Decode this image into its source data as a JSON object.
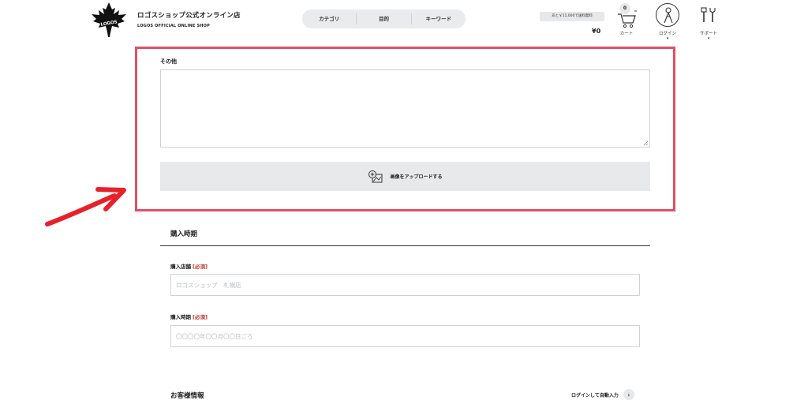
{
  "header": {
    "logo_text": "LOGOS",
    "brand_name_ja": "ロゴスショップ公式オンライン店",
    "brand_name_en": "LOGOS OFFICIAL ONLINE SHOP",
    "nav": [
      {
        "label": "カテゴリ"
      },
      {
        "label": "目的"
      },
      {
        "label": "キーワード"
      }
    ],
    "shipping_note": "あと￥11,000で送料無料",
    "cart_total": "¥0",
    "cart_count": "0",
    "cart_label": "カート",
    "login_label": "ログイン",
    "support_label": "サポート",
    "caret": "▾"
  },
  "other_section": {
    "label": "その他",
    "textarea_value": "",
    "upload_button_label": "画像をアップロードする"
  },
  "purchase_section": {
    "title": "購入時期",
    "store_field": {
      "label": "購入店舗",
      "required": "[必須]",
      "placeholder": "ロゴスショップ　札幌店"
    },
    "date_field": {
      "label": "購入時期",
      "required": "[必須]",
      "placeholder": "〇〇〇〇年〇〇月〇〇日ごろ"
    }
  },
  "customer_section": {
    "title": "お客様情報",
    "auto_login_label": "ログインして自動入力",
    "auto_login_arrow": "›"
  },
  "colors": {
    "highlight": "#e05065",
    "arrow": "#e8202a",
    "required": "#c0392b"
  },
  "icons": [
    "maple-leaf-logo-icon",
    "cart-icon",
    "person-icon",
    "tools-icon",
    "add-image-icon",
    "chevron-right-icon",
    "red-arrow-annotation"
  ]
}
